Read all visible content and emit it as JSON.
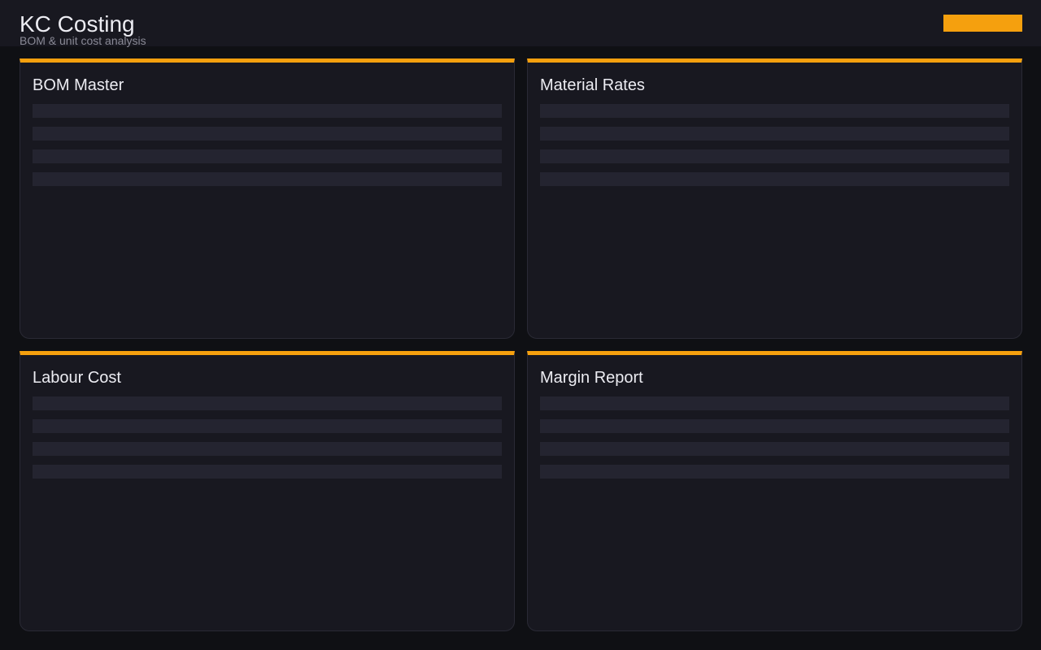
{
  "header": {
    "title": "KC Costing",
    "subtitle": "BOM & unit cost analysis",
    "action_label": ""
  },
  "colors": {
    "accent": "#f5a00e",
    "background": "#0f1014",
    "card": "#181820",
    "placeholder": "#242430"
  },
  "cards": [
    {
      "title": "BOM Master"
    },
    {
      "title": "Material Rates"
    },
    {
      "title": "Labour Cost"
    },
    {
      "title": "Margin Report"
    }
  ]
}
